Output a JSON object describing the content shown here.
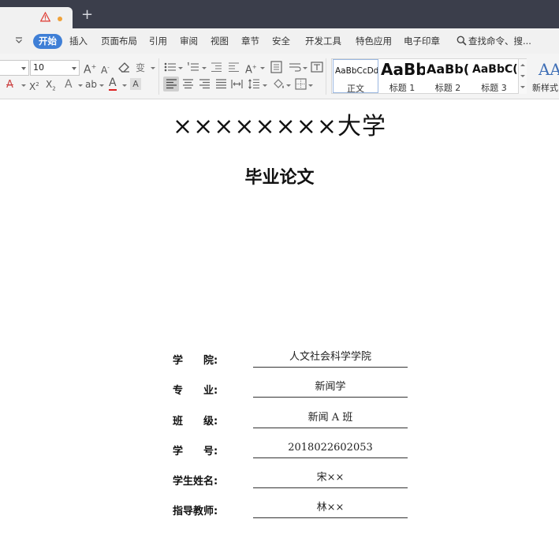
{
  "tabbar": {
    "new_tab_glyph": "+"
  },
  "menu": {
    "items": [
      "开始",
      "插入",
      "页面布局",
      "引用",
      "审阅",
      "视图",
      "章节",
      "安全",
      "开发工具",
      "特色应用",
      "电子印章"
    ],
    "search_label": "查找命令、搜..."
  },
  "ribbon": {
    "font_size": "10",
    "styles": [
      {
        "sample": "AaBbCcDd",
        "name": "正文"
      },
      {
        "sample": "AaBb",
        "name": "标题 1"
      },
      {
        "sample": "AaBb(",
        "name": "标题 2"
      },
      {
        "sample": "AaBbC(",
        "name": "标题 3"
      }
    ],
    "new_style_label": "新样式"
  },
  "colors": {
    "accent": "#3f7fd6",
    "tabbar": "#3b3e4b",
    "warning": "#e0463e",
    "modified_dot": "#f0a23a"
  },
  "document": {
    "university": "××××××××大学",
    "thesis_title": "毕业论文",
    "fields": [
      {
        "label": "学　　院:",
        "value": "人文社会科学学院"
      },
      {
        "label": "专　　业:",
        "value": "新闻学"
      },
      {
        "label": "班　　级:",
        "value": "新闻 A 班"
      },
      {
        "label": "学　　号:",
        "value": "2018022602053"
      },
      {
        "label": "学生姓名:",
        "value": "宋××"
      },
      {
        "label": "指导教师:",
        "value": "林××"
      }
    ]
  }
}
